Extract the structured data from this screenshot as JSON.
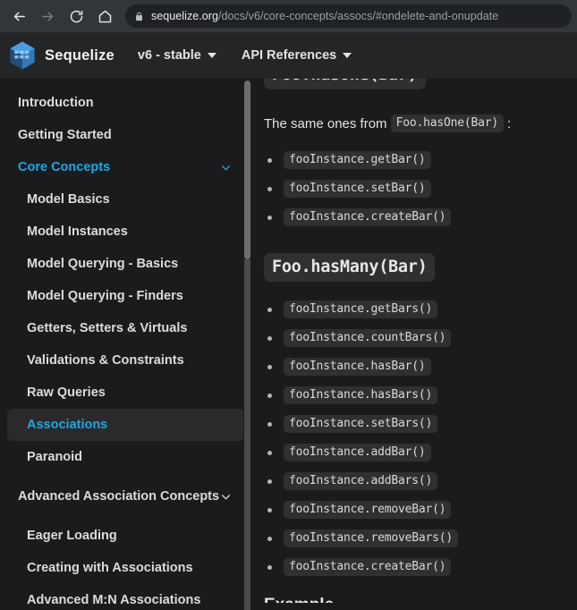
{
  "browser": {
    "back_icon": "back-arrow-icon",
    "forward_icon": "forward-arrow-icon",
    "reload_icon": "reload-icon",
    "home_icon": "home-icon",
    "lock_icon": "lock-icon",
    "url_domain": "sequelize.org",
    "url_path": "/docs/v6/core-concepts/assocs/#ondelete-and-onupdate"
  },
  "header": {
    "brand_name": "Sequelize",
    "logo_icon": "sequelize-cube-logo-icon",
    "nav": [
      {
        "label": "v6 - stable",
        "caret": "chevron-down-icon"
      },
      {
        "label": "API References",
        "caret": "chevron-down-icon"
      }
    ]
  },
  "sidebar": {
    "items": [
      {
        "label": "Introduction",
        "level": 1,
        "active": false,
        "chevron": false
      },
      {
        "label": "Getting Started",
        "level": 1,
        "active": false,
        "chevron": false
      },
      {
        "label": "Core Concepts",
        "level": 1,
        "active": false,
        "category": true,
        "chevron": true
      },
      {
        "label": "Model Basics",
        "level": 2,
        "active": false,
        "chevron": false
      },
      {
        "label": "Model Instances",
        "level": 2,
        "active": false,
        "chevron": false
      },
      {
        "label": "Model Querying - Basics",
        "level": 2,
        "active": false,
        "chevron": false
      },
      {
        "label": "Model Querying - Finders",
        "level": 2,
        "active": false,
        "chevron": false
      },
      {
        "label": "Getters, Setters & Virtuals",
        "level": 2,
        "active": false,
        "chevron": false
      },
      {
        "label": "Validations & Constraints",
        "level": 2,
        "active": false,
        "chevron": false
      },
      {
        "label": "Raw Queries",
        "level": 2,
        "active": false,
        "chevron": false
      },
      {
        "label": "Associations",
        "level": 2,
        "active": true,
        "chevron": false
      },
      {
        "label": "Paranoid",
        "level": 2,
        "active": false,
        "chevron": false
      },
      {
        "label": "Advanced Association Concepts",
        "level": 1,
        "active": false,
        "chevron": true,
        "tall": true
      },
      {
        "label": "Eager Loading",
        "level": 2,
        "active": false,
        "chevron": false
      },
      {
        "label": "Creating with Associations",
        "level": 2,
        "active": false,
        "chevron": false
      },
      {
        "label": "Advanced M:N Associations",
        "level": 2,
        "active": false,
        "chevron": false
      }
    ]
  },
  "content": {
    "clipped_heading": "Foo.hasOne(Bar)",
    "paragraph_prefix": "The same ones from",
    "paragraph_code": "Foo.hasOne(Bar)",
    "paragraph_suffix": ":",
    "hasone_methods": [
      "fooInstance.getBar()",
      "fooInstance.setBar()",
      "fooInstance.createBar()"
    ],
    "hasmany_heading": "Foo.hasMany(Bar)",
    "hasmany_methods": [
      "fooInstance.getBars()",
      "fooInstance.countBars()",
      "fooInstance.hasBar()",
      "fooInstance.hasBars()",
      "fooInstance.setBars()",
      "fooInstance.addBar()",
      "fooInstance.addBars()",
      "fooInstance.removeBar()",
      "fooInstance.removeBars()",
      "fooInstance.createBar()"
    ],
    "next_heading": "Example"
  },
  "colors": {
    "page_bg": "#1b1b1d",
    "header_bg": "#242526",
    "chrome_bg": "#323639",
    "omnibox_bg": "#202124",
    "accent_blue": "#1ea7e0",
    "code_bg": "#303032",
    "active_item_bg": "#2a2a2c"
  }
}
